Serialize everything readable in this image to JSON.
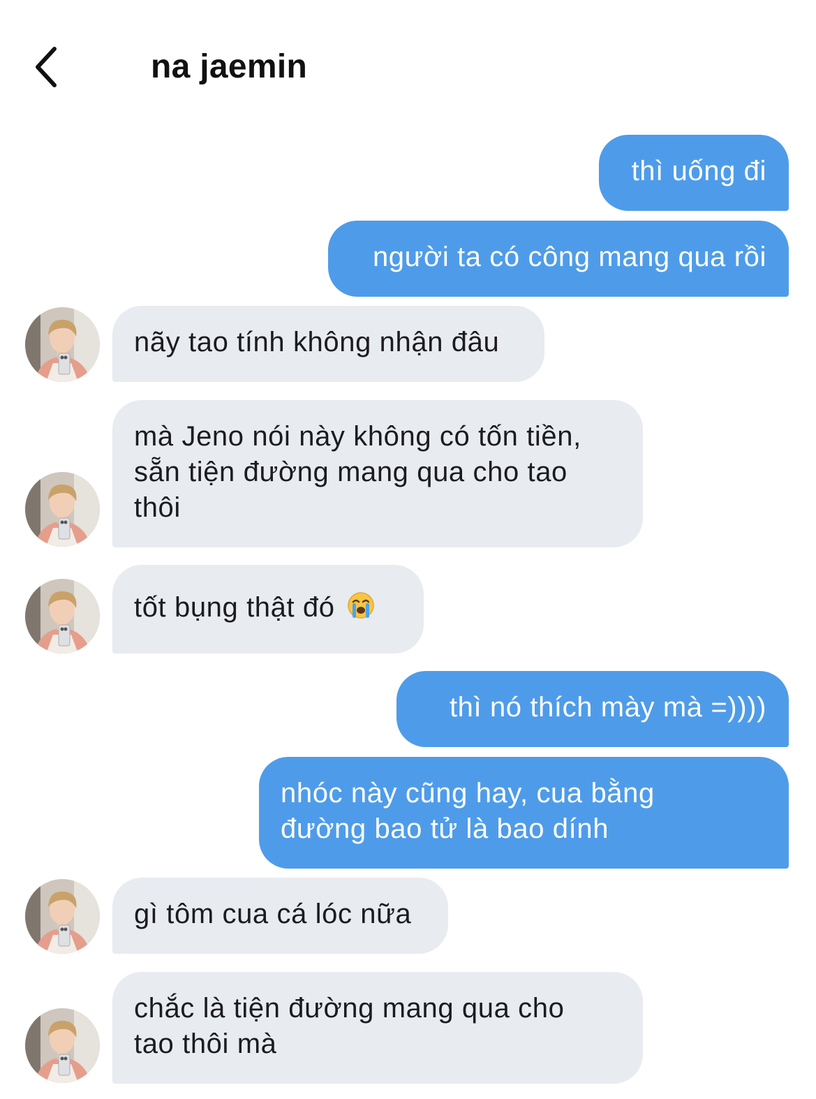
{
  "header": {
    "title": "na jaemin",
    "back_icon": "chevron-left-icon"
  },
  "colors": {
    "outgoing_bubble": "#4e9ce9",
    "incoming_bubble": "#e8ebf0"
  },
  "messages": [
    {
      "direction": "outgoing",
      "text": "thì uống đi"
    },
    {
      "direction": "outgoing",
      "text": "người ta có công mang qua rồi"
    },
    {
      "direction": "incoming",
      "text": "nãy tao tính không nhận đâu"
    },
    {
      "direction": "incoming",
      "lines": [
        "mà Jeno nói này không có tốn tiền,",
        "sẵn tiện đường mang qua cho tao",
        "thôi"
      ]
    },
    {
      "direction": "incoming",
      "text": "tốt bụng thật đó",
      "emoji": "loudly-crying-face-emoji"
    },
    {
      "direction": "outgoing",
      "text": "thì nó thích mày mà =))))"
    },
    {
      "direction": "outgoing",
      "lines": [
        "nhóc này cũng hay, cua bằng",
        "đường bao tử là bao dính"
      ]
    },
    {
      "direction": "incoming",
      "text": "gì tôm cua cá lóc nữa"
    },
    {
      "direction": "incoming",
      "lines": [
        "chắc là tiện đường mang qua cho",
        "tao thôi mà"
      ]
    }
  ]
}
